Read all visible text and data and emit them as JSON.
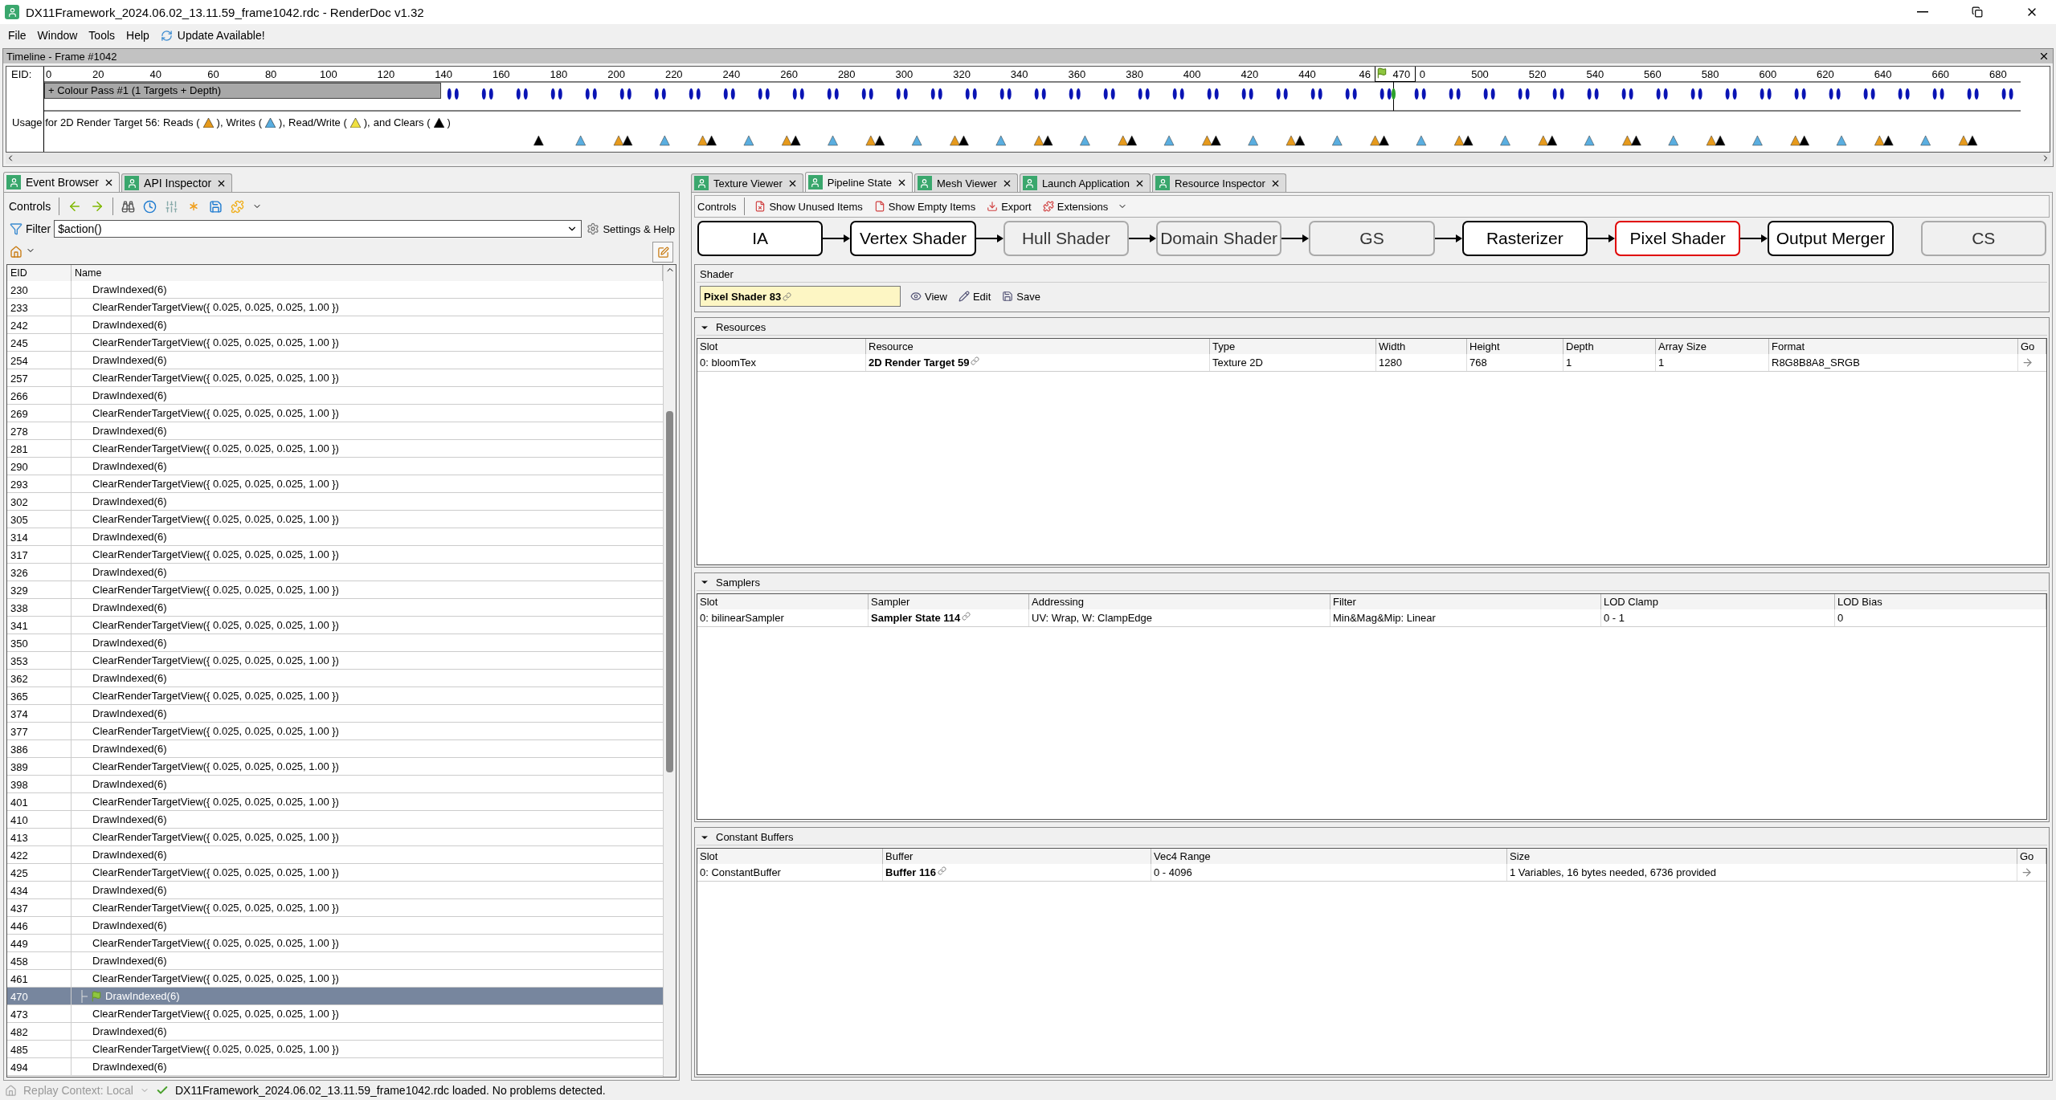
{
  "window": {
    "title": "DX11Framework_2024.06.02_13.11.59_frame1042.rdc - RenderDoc v1.32"
  },
  "menu": [
    "File",
    "Window",
    "Tools",
    "Help"
  ],
  "update_notice": "Update Available!",
  "timeline": {
    "title": "Timeline - Frame #1042",
    "eid_label": "EID:",
    "ticks": [
      "0",
      "20",
      "40",
      "60",
      "80",
      "100",
      "120",
      "140",
      "160",
      "180",
      "200",
      "220",
      "240",
      "260",
      "280",
      "300",
      "320",
      "340",
      "360",
      "380",
      "400",
      "420",
      "440",
      "46",
      "0",
      "500",
      "520",
      "540",
      "560",
      "580",
      "600",
      "620",
      "640",
      "660",
      "680"
    ],
    "current_label": "470",
    "pass_label": "+ Colour Pass #1 (1 Targets + Depth)",
    "usage_title": "Usage for 2D Render Target 56:",
    "legend": [
      {
        "before": "Reads (",
        "after": "),",
        "color": "#e69a1c"
      },
      {
        "before": "Writes (",
        "after": "),",
        "color": "#5aaee0"
      },
      {
        "before": "Read/Write (",
        "after": "),",
        "color": "#f0e040"
      },
      {
        "before": "and Clears (",
        "after": ")",
        "color": "#000000"
      }
    ]
  },
  "left_tabs": [
    {
      "label": "Event Browser",
      "selected": true
    },
    {
      "label": "API Inspector",
      "selected": false
    }
  ],
  "event_browser": {
    "controls_label": "Controls",
    "filter_label": "Filter",
    "filter_value": "$action()",
    "settings": "Settings & Help",
    "columns": [
      "EID",
      "Name"
    ],
    "rows": [
      {
        "eid": "230",
        "name": "DrawIndexed(6)",
        "selected": false
      },
      {
        "eid": "233",
        "name": "ClearRenderTargetView({ 0.025, 0.025, 0.025, 1.00 })",
        "selected": false
      },
      {
        "eid": "242",
        "name": "DrawIndexed(6)",
        "selected": false
      },
      {
        "eid": "245",
        "name": "ClearRenderTargetView({ 0.025, 0.025, 0.025, 1.00 })",
        "selected": false
      },
      {
        "eid": "254",
        "name": "DrawIndexed(6)",
        "selected": false
      },
      {
        "eid": "257",
        "name": "ClearRenderTargetView({ 0.025, 0.025, 0.025, 1.00 })",
        "selected": false
      },
      {
        "eid": "266",
        "name": "DrawIndexed(6)",
        "selected": false
      },
      {
        "eid": "269",
        "name": "ClearRenderTargetView({ 0.025, 0.025, 0.025, 1.00 })",
        "selected": false
      },
      {
        "eid": "278",
        "name": "DrawIndexed(6)",
        "selected": false
      },
      {
        "eid": "281",
        "name": "ClearRenderTargetView({ 0.025, 0.025, 0.025, 1.00 })",
        "selected": false
      },
      {
        "eid": "290",
        "name": "DrawIndexed(6)",
        "selected": false
      },
      {
        "eid": "293",
        "name": "ClearRenderTargetView({ 0.025, 0.025, 0.025, 1.00 })",
        "selected": false
      },
      {
        "eid": "302",
        "name": "DrawIndexed(6)",
        "selected": false
      },
      {
        "eid": "305",
        "name": "ClearRenderTargetView({ 0.025, 0.025, 0.025, 1.00 })",
        "selected": false
      },
      {
        "eid": "314",
        "name": "DrawIndexed(6)",
        "selected": false
      },
      {
        "eid": "317",
        "name": "ClearRenderTargetView({ 0.025, 0.025, 0.025, 1.00 })",
        "selected": false
      },
      {
        "eid": "326",
        "name": "DrawIndexed(6)",
        "selected": false
      },
      {
        "eid": "329",
        "name": "ClearRenderTargetView({ 0.025, 0.025, 0.025, 1.00 })",
        "selected": false
      },
      {
        "eid": "338",
        "name": "DrawIndexed(6)",
        "selected": false
      },
      {
        "eid": "341",
        "name": "ClearRenderTargetView({ 0.025, 0.025, 0.025, 1.00 })",
        "selected": false
      },
      {
        "eid": "350",
        "name": "DrawIndexed(6)",
        "selected": false
      },
      {
        "eid": "353",
        "name": "ClearRenderTargetView({ 0.025, 0.025, 0.025, 1.00 })",
        "selected": false
      },
      {
        "eid": "362",
        "name": "DrawIndexed(6)",
        "selected": false
      },
      {
        "eid": "365",
        "name": "ClearRenderTargetView({ 0.025, 0.025, 0.025, 1.00 })",
        "selected": false
      },
      {
        "eid": "374",
        "name": "DrawIndexed(6)",
        "selected": false
      },
      {
        "eid": "377",
        "name": "ClearRenderTargetView({ 0.025, 0.025, 0.025, 1.00 })",
        "selected": false
      },
      {
        "eid": "386",
        "name": "DrawIndexed(6)",
        "selected": false
      },
      {
        "eid": "389",
        "name": "ClearRenderTargetView({ 0.025, 0.025, 0.025, 1.00 })",
        "selected": false
      },
      {
        "eid": "398",
        "name": "DrawIndexed(6)",
        "selected": false
      },
      {
        "eid": "401",
        "name": "ClearRenderTargetView({ 0.025, 0.025, 0.025, 1.00 })",
        "selected": false
      },
      {
        "eid": "410",
        "name": "DrawIndexed(6)",
        "selected": false
      },
      {
        "eid": "413",
        "name": "ClearRenderTargetView({ 0.025, 0.025, 0.025, 1.00 })",
        "selected": false
      },
      {
        "eid": "422",
        "name": "DrawIndexed(6)",
        "selected": false
      },
      {
        "eid": "425",
        "name": "ClearRenderTargetView({ 0.025, 0.025, 0.025, 1.00 })",
        "selected": false
      },
      {
        "eid": "434",
        "name": "DrawIndexed(6)",
        "selected": false
      },
      {
        "eid": "437",
        "name": "ClearRenderTargetView({ 0.025, 0.025, 0.025, 1.00 })",
        "selected": false
      },
      {
        "eid": "446",
        "name": "DrawIndexed(6)",
        "selected": false
      },
      {
        "eid": "449",
        "name": "ClearRenderTargetView({ 0.025, 0.025, 0.025, 1.00 })",
        "selected": false
      },
      {
        "eid": "458",
        "name": "DrawIndexed(6)",
        "selected": false
      },
      {
        "eid": "461",
        "name": "ClearRenderTargetView({ 0.025, 0.025, 0.025, 1.00 })",
        "selected": false
      },
      {
        "eid": "470",
        "name": "DrawIndexed(6)",
        "selected": true
      },
      {
        "eid": "473",
        "name": "ClearRenderTargetView({ 0.025, 0.025, 0.025, 1.00 })",
        "selected": false
      },
      {
        "eid": "482",
        "name": "DrawIndexed(6)",
        "selected": false
      },
      {
        "eid": "485",
        "name": "ClearRenderTargetView({ 0.025, 0.025, 0.025, 1.00 })",
        "selected": false
      },
      {
        "eid": "494",
        "name": "DrawIndexed(6)",
        "selected": false
      }
    ]
  },
  "right_tabs": [
    {
      "label": "Texture Viewer",
      "selected": false
    },
    {
      "label": "Pipeline State",
      "selected": true
    },
    {
      "label": "Mesh Viewer",
      "selected": false
    },
    {
      "label": "Launch Application",
      "selected": false
    },
    {
      "label": "Resource Inspector",
      "selected": false
    }
  ],
  "pipeline_toolbar": {
    "controls_label": "Controls",
    "buttons": [
      {
        "kind": "unused",
        "label": "Show Unused Items"
      },
      {
        "kind": "empty",
        "label": "Show Empty Items"
      },
      {
        "kind": "export",
        "label": "Export"
      },
      {
        "kind": "extensions",
        "label": "Extensions"
      }
    ]
  },
  "stages": [
    {
      "label": "IA",
      "enabled": true,
      "selected": false
    },
    {
      "label": "Vertex Shader",
      "enabled": true,
      "selected": false
    },
    {
      "label": "Hull Shader",
      "enabled": false,
      "selected": false
    },
    {
      "label": "Domain Shader",
      "enabled": false,
      "selected": false
    },
    {
      "label": "GS",
      "enabled": false,
      "selected": false
    },
    {
      "label": "Rasterizer",
      "enabled": true,
      "selected": false
    },
    {
      "label": "Pixel Shader",
      "enabled": true,
      "selected": true
    },
    {
      "label": "Output Merger",
      "enabled": true,
      "selected": false
    },
    {
      "label": "CS",
      "enabled": false,
      "selected": false
    }
  ],
  "shader": {
    "title": "Shader",
    "name": "Pixel Shader 83",
    "buttons": [
      {
        "kind": "view",
        "label": "View"
      },
      {
        "kind": "edit",
        "label": "Edit"
      },
      {
        "kind": "save",
        "label": "Save"
      }
    ]
  },
  "sections": [
    {
      "title": "Resources",
      "columns": [
        "Slot",
        "Resource",
        "Type",
        "Width",
        "Height",
        "Depth",
        "Array Size",
        "Format",
        "Go"
      ],
      "rows": [
        [
          {
            "kind": "text",
            "text": "0: bloomTex"
          },
          {
            "kind": "link",
            "text": "2D Render Target 59"
          },
          {
            "kind": "text",
            "text": "Texture 2D"
          },
          {
            "kind": "text",
            "text": "1280"
          },
          {
            "kind": "text",
            "text": "768"
          },
          {
            "kind": "text",
            "text": "1"
          },
          {
            "kind": "text",
            "text": "1"
          },
          {
            "kind": "text",
            "text": "R8G8B8A8_SRGB"
          },
          {
            "kind": "go"
          }
        ]
      ]
    },
    {
      "title": "Samplers",
      "columns": [
        "Slot",
        "Sampler",
        "Addressing",
        "Filter",
        "LOD Clamp",
        "LOD Bias"
      ],
      "rows": [
        [
          {
            "kind": "text",
            "text": "0: bilinearSampler"
          },
          {
            "kind": "link",
            "text": "Sampler State 114"
          },
          {
            "kind": "text",
            "text": "UV: Wrap, W: ClampEdge"
          },
          {
            "kind": "text",
            "text": "Min&Mag&Mip: Linear"
          },
          {
            "kind": "text",
            "text": "0 - 1"
          },
          {
            "kind": "text",
            "text": "0"
          }
        ]
      ]
    },
    {
      "title": "Constant Buffers",
      "columns": [
        "Slot",
        "Buffer",
        "Vec4 Range",
        "Size",
        "Go"
      ],
      "rows": [
        [
          {
            "kind": "text",
            "text": "0: ConstantBuffer"
          },
          {
            "kind": "link",
            "text": "Buffer 116"
          },
          {
            "kind": "text",
            "text": "0 - 4096"
          },
          {
            "kind": "text",
            "text": "1 Variables, 16 bytes needed, 6736 provided"
          },
          {
            "kind": "go"
          }
        ]
      ]
    }
  ],
  "status_bar": {
    "context": "Replay Context: Local",
    "message": "DX11Framework_2024.06.02_13.11.59_frame1042.rdc loaded. No problems detected."
  }
}
